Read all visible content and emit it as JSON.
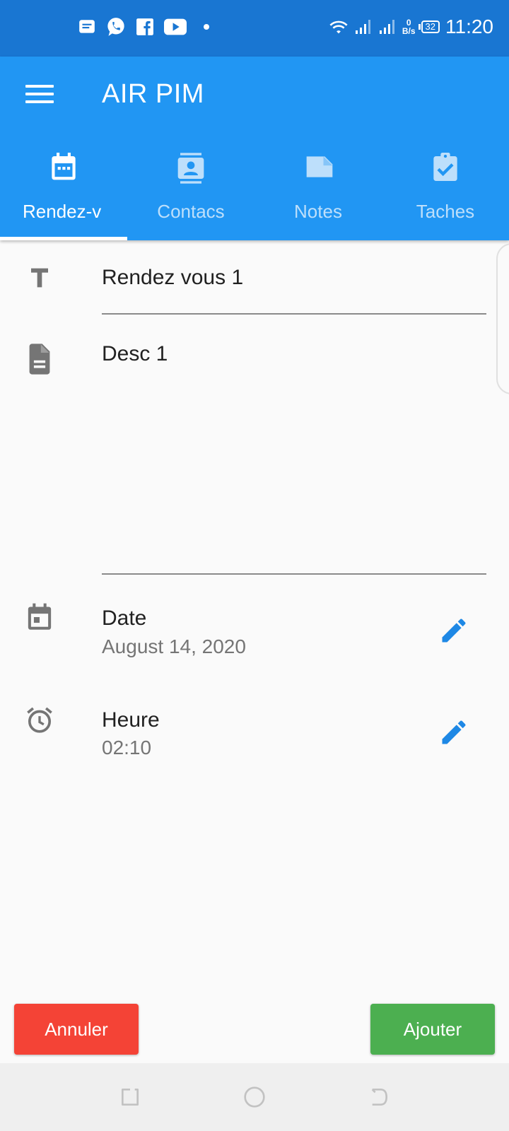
{
  "status_bar": {
    "time": "11:20",
    "net_speed_value": "0",
    "net_speed_unit": "B/s",
    "battery": "32",
    "icons": [
      "message-icon",
      "whatsapp-icon",
      "facebook-icon",
      "youtube-icon",
      "dot-icon",
      "wifi-icon",
      "signal-icon",
      "signal-icon"
    ]
  },
  "app_bar": {
    "title": "AIR PIM",
    "menu_icon": "menu-icon"
  },
  "tabs": [
    {
      "label": "Rendez-v",
      "icon": "calendar-icon",
      "active": true
    },
    {
      "label": "Contacs",
      "icon": "contact-card-icon",
      "active": false
    },
    {
      "label": "Notes",
      "icon": "note-icon",
      "active": false
    },
    {
      "label": "Taches",
      "icon": "clipboard-check-icon",
      "active": false
    }
  ],
  "form": {
    "title_value": "Rendez vous 1",
    "description_value": "Desc 1",
    "date_label": "Date",
    "date_value": "August 14, 2020",
    "time_label": "Heure",
    "time_value": "02:10"
  },
  "actions": {
    "cancel_label": "Annuler",
    "add_label": "Ajouter"
  },
  "colors": {
    "status_bar": "#1976d2",
    "app_bar": "#2196f3",
    "cancel": "#f44336",
    "add": "#4caf50",
    "edit_icon": "#1e88e5"
  }
}
